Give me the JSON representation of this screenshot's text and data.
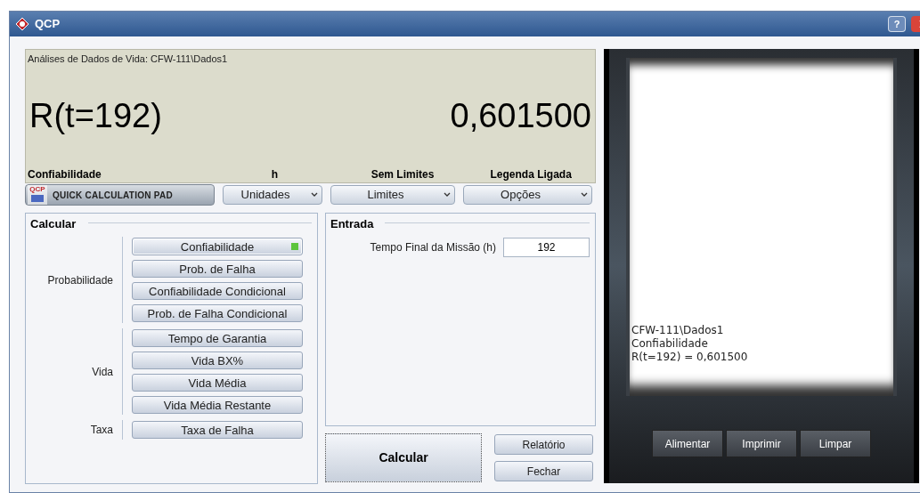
{
  "window": {
    "title": "QCP",
    "help": "?"
  },
  "display": {
    "source": "Análises de Dados de Vida: CFW-111\\Dados1",
    "expression": "R(t=192)",
    "value": "0,601500",
    "labels": [
      "Confiabilidade",
      "h",
      "Sem Limites",
      "Legenda Ligada"
    ]
  },
  "toolbar": {
    "icon_label": "QCP",
    "pad_button": "QUICK CALCULATION PAD",
    "dropdowns": [
      "Unidades",
      "Limites",
      "Opções"
    ]
  },
  "calcular": {
    "title": "Calcular",
    "groups": [
      {
        "label": "Probabilidade",
        "items": [
          {
            "label": "Confiabilidade",
            "selected": true
          },
          {
            "label": "Prob. de Falha",
            "selected": false
          },
          {
            "label": "Confiabilidade Condicional",
            "selected": false
          },
          {
            "label": "Prob. de Falha Condicional",
            "selected": false
          }
        ]
      },
      {
        "label": "Vida",
        "items": [
          {
            "label": "Tempo de Garantia",
            "selected": false
          },
          {
            "label": "Vida BX%",
            "selected": false
          },
          {
            "label": "Vida Média",
            "selected": false
          },
          {
            "label": "Vida Média Restante",
            "selected": false
          }
        ]
      },
      {
        "label": "Taxa",
        "items": [
          {
            "label": "Taxa de Falha",
            "selected": false
          }
        ]
      }
    ]
  },
  "entrada": {
    "title": "Entrada",
    "fields": [
      {
        "label": "Tempo Final da Missão (h)",
        "value": "192"
      }
    ]
  },
  "actions": {
    "calculate": "Calcular",
    "side": [
      "Relatório",
      "Fechar"
    ]
  },
  "printer": {
    "lines": [
      "CFW-111\\Dados1",
      "Confiabilidade",
      "R(t=192) = 0,601500"
    ],
    "buttons": [
      "Alimentar",
      "Imprimir",
      "Limpar"
    ]
  }
}
